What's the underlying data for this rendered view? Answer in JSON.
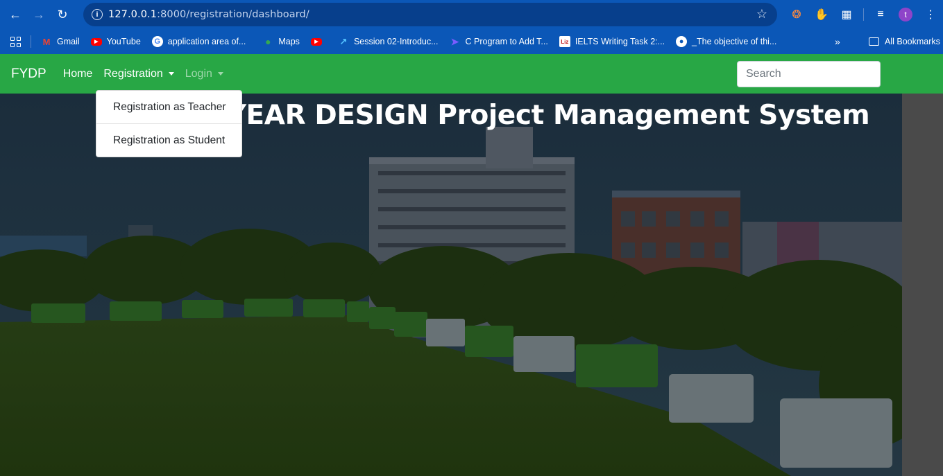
{
  "browser": {
    "url_host": "127.0.0.1",
    "url_rest": ":8000/registration/dashboard/",
    "profile_initial": "t"
  },
  "bookmarks": {
    "items": [
      {
        "label": "Gmail",
        "icon": "gmail-icon"
      },
      {
        "label": "YouTube",
        "icon": "youtube-icon"
      },
      {
        "label": "application area of...",
        "icon": "google-icon"
      },
      {
        "label": "Maps",
        "icon": "maps-icon"
      },
      {
        "label": "",
        "icon": "youtube-icon"
      },
      {
        "label": "Session 02-Introduc...",
        "icon": "session-icon"
      },
      {
        "label": "C Program to Add T...",
        "icon": "c-program-icon"
      },
      {
        "label": "IELTS Writing Task 2:...",
        "icon": "liz-icon"
      },
      {
        "label": "_The objective of thi...",
        "icon": "globe-icon"
      }
    ],
    "more": "»",
    "all_bookmarks": "All Bookmarks"
  },
  "navbar": {
    "brand": "FYDP",
    "home": "Home",
    "registration": "Registration",
    "login": "Login",
    "search_placeholder": "Search",
    "color": "#28a745"
  },
  "dropdown": {
    "items": [
      "Registration as Teacher",
      "Registration as Student"
    ]
  },
  "hero": {
    "title": "FINAL YEAR DESIGN Project Management System"
  }
}
